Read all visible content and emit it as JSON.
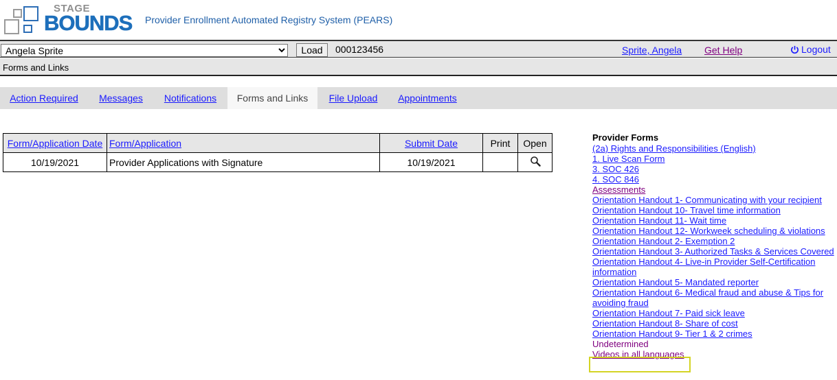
{
  "header": {
    "logo_top": "STAGE",
    "logo_main": "BOUNDS",
    "app_title": "Provider Enrollment Automated Registry System (PEARS)"
  },
  "toolbar": {
    "selected_user": "Angela Sprite",
    "load_label": "Load",
    "case_number": "000123456",
    "user_link": "Sprite, Angela",
    "help_link": "Get Help",
    "logout_label": "Logout"
  },
  "breadcrumb": "Forms and Links",
  "tabs": [
    {
      "label": "Action Required"
    },
    {
      "label": "Messages"
    },
    {
      "label": "Notifications"
    },
    {
      "label": "Forms and Links",
      "active": true
    },
    {
      "label": "File Upload"
    },
    {
      "label": "Appointments"
    }
  ],
  "table": {
    "headers": [
      "Form/Application Date",
      "Form/Application",
      "Submit Date",
      "Print",
      "Open"
    ],
    "rows": [
      {
        "date": "10/19/2021",
        "form": "Provider Applications with Signature",
        "submit_date": "10/19/2021",
        "print": "",
        "open_icon": "magnifier-icon"
      }
    ]
  },
  "provider_forms": {
    "title": "Provider Forms",
    "items": [
      {
        "label": "(2a) Rights and Responsibilities (English)",
        "kind": "link"
      },
      {
        "label": "1. Live Scan Form",
        "kind": "link"
      },
      {
        "label": "3. SOC 426",
        "kind": "link"
      },
      {
        "label": "4. SOC 846",
        "kind": "link"
      },
      {
        "label": "Assessments",
        "kind": "visited"
      },
      {
        "label": "Orientation Handout 1- Communicating with your recipient",
        "kind": "link"
      },
      {
        "label": "Orientation Handout 10- Travel time information",
        "kind": "link"
      },
      {
        "label": "Orientation Handout 11- Wait time",
        "kind": "link"
      },
      {
        "label": "Orientation Handout 12- Workweek scheduling & violations",
        "kind": "link"
      },
      {
        "label": "Orientation Handout 2- Exemption 2",
        "kind": "link"
      },
      {
        "label": "Orientation Handout 3- Authorized Tasks & Services Covered",
        "kind": "link"
      },
      {
        "label": "Orientation Handout 4- Live-in Provider Self-Certification information",
        "kind": "link"
      },
      {
        "label": "Orientation Handout 5- Mandated reporter",
        "kind": "link"
      },
      {
        "label": "Orientation Handout 6- Medical fraud and abuse & Tips for avoiding fraud",
        "kind": "link"
      },
      {
        "label": "Orientation Handout 7- Paid sick leave",
        "kind": "link"
      },
      {
        "label": "Orientation Handout 8- Share of cost",
        "kind": "link"
      },
      {
        "label": "Orientation Handout 9- Tier 1 & 2 crimes",
        "kind": "link"
      },
      {
        "label": "Undetermined",
        "kind": "text"
      },
      {
        "label": "Videos in all languages",
        "kind": "visited"
      }
    ]
  }
}
